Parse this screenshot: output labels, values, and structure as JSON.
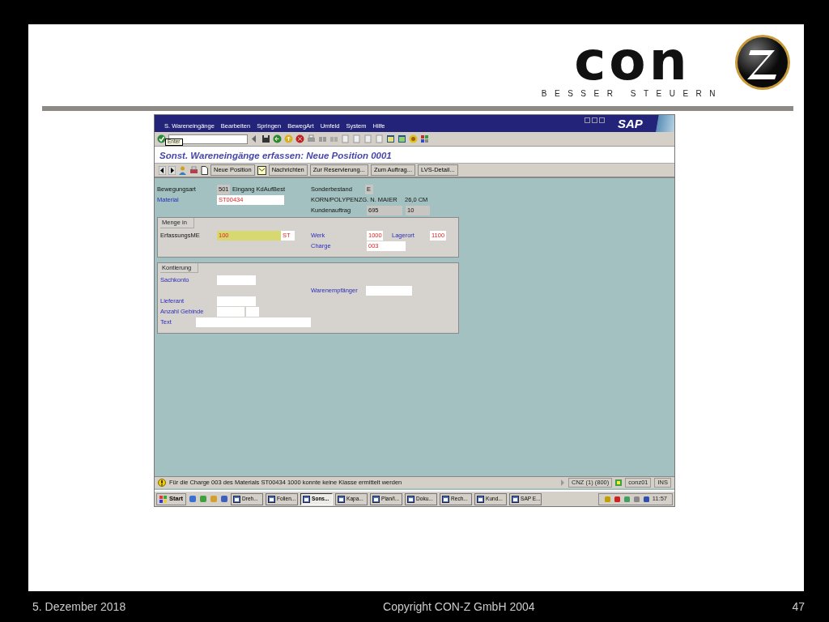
{
  "slide": {
    "logo": {
      "wordmark": "con",
      "tagline": "BESSER STEUERN"
    }
  },
  "sap_window": {
    "menu": [
      "S. Wareneingänge",
      "Bearbeiten",
      "Springen",
      "BewegArt",
      "Umfeld",
      "System",
      "Hilfe"
    ],
    "brand": "SAP",
    "tooltip": "Enter",
    "title": "Sonst. Wareneingänge erfassen: Neue Position 0001",
    "app_toolbar": [
      {
        "label": "Neue Position",
        "kind": "icon"
      },
      {
        "label": "Nachrichten",
        "kind": "icon"
      },
      {
        "label": "Zur Reservierung...",
        "kind": "plain"
      },
      {
        "label": "Zum Auftrag...",
        "kind": "plain"
      },
      {
        "label": "LVS-Detail...",
        "kind": "plain"
      }
    ],
    "header": {
      "movement_type": {
        "label": "Bewegungsart",
        "value": "501",
        "text": "Eingang KdAufBest"
      },
      "special_stock": {
        "label": "Sonderbestand",
        "value": "E"
      },
      "material": {
        "label": "Material",
        "value": "ST00434"
      },
      "material_text": "KORN/POLYPENZG. N. MAIER",
      "size": "26,0 CM",
      "sales_order": {
        "label": "Kundenauftrag",
        "values": [
          "695",
          "10"
        ]
      }
    },
    "quantity_group": {
      "title": "Menge in",
      "entry_unit": {
        "label": "ErfassungsME",
        "value": "100",
        "unit": "ST"
      },
      "plant": {
        "label": "Werk",
        "value": "1000"
      },
      "storage_location": {
        "label": "Lagerort",
        "value": "1100"
      },
      "batch": {
        "label": "Charge",
        "value": "003"
      }
    },
    "account_group": {
      "title": "Kontierung",
      "gl_account": {
        "label": "Sachkonto"
      },
      "goods_recipient": {
        "label": "Warenempfänger"
      },
      "vendor": {
        "label": "Lieferant"
      },
      "packages": {
        "label": "Anzahl Gebinde"
      },
      "text": {
        "label": "Text"
      }
    },
    "status_bar": {
      "message": "Für die Charge 003 des Materials ST00434 1000 konnte keine Klasse ermittelt werden",
      "system": "CNZ (1) (800)",
      "user": "conz01",
      "mode": "INS"
    },
    "taskbar": {
      "start": "Start",
      "tasks": [
        {
          "label": "Dreh...",
          "selected": false
        },
        {
          "label": "Folien...",
          "selected": false
        },
        {
          "label": "Sons...",
          "selected": true
        },
        {
          "label": "Kapa...",
          "selected": false
        },
        {
          "label": "Plan/I...",
          "selected": false
        },
        {
          "label": "Doku...",
          "selected": false
        },
        {
          "label": "Rech...",
          "selected": false
        },
        {
          "label": "Kund...",
          "selected": false
        },
        {
          "label": "SAP E...",
          "selected": false
        }
      ],
      "clock": "11:57"
    }
  },
  "footer": {
    "date": "5. Dezember 2018",
    "copyright": "Copyright CON-Z GmbH 2004",
    "page": "47"
  }
}
